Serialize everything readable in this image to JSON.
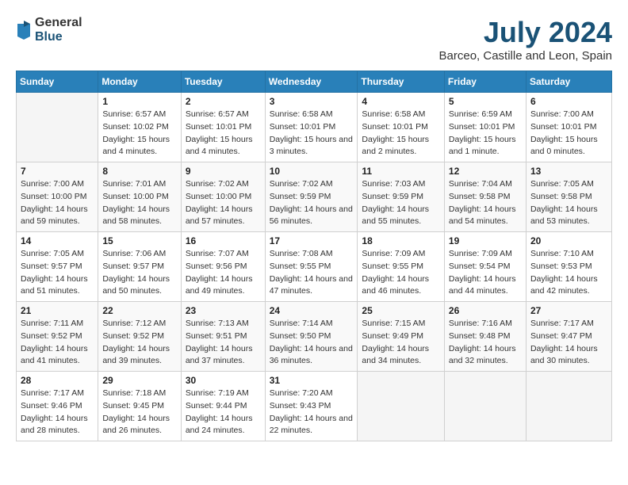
{
  "logo": {
    "general": "General",
    "blue": "Blue"
  },
  "title": "July 2024",
  "subtitle": "Barceo, Castille and Leon, Spain",
  "headers": [
    "Sunday",
    "Monday",
    "Tuesday",
    "Wednesday",
    "Thursday",
    "Friday",
    "Saturday"
  ],
  "weeks": [
    [
      {
        "day": "",
        "sunrise": "",
        "sunset": "",
        "daylight": ""
      },
      {
        "day": "1",
        "sunrise": "Sunrise: 6:57 AM",
        "sunset": "Sunset: 10:02 PM",
        "daylight": "Daylight: 15 hours and 4 minutes."
      },
      {
        "day": "2",
        "sunrise": "Sunrise: 6:57 AM",
        "sunset": "Sunset: 10:01 PM",
        "daylight": "Daylight: 15 hours and 4 minutes."
      },
      {
        "day": "3",
        "sunrise": "Sunrise: 6:58 AM",
        "sunset": "Sunset: 10:01 PM",
        "daylight": "Daylight: 15 hours and 3 minutes."
      },
      {
        "day": "4",
        "sunrise": "Sunrise: 6:58 AM",
        "sunset": "Sunset: 10:01 PM",
        "daylight": "Daylight: 15 hours and 2 minutes."
      },
      {
        "day": "5",
        "sunrise": "Sunrise: 6:59 AM",
        "sunset": "Sunset: 10:01 PM",
        "daylight": "Daylight: 15 hours and 1 minute."
      },
      {
        "day": "6",
        "sunrise": "Sunrise: 7:00 AM",
        "sunset": "Sunset: 10:01 PM",
        "daylight": "Daylight: 15 hours and 0 minutes."
      }
    ],
    [
      {
        "day": "7",
        "sunrise": "Sunrise: 7:00 AM",
        "sunset": "Sunset: 10:00 PM",
        "daylight": "Daylight: 14 hours and 59 minutes."
      },
      {
        "day": "8",
        "sunrise": "Sunrise: 7:01 AM",
        "sunset": "Sunset: 10:00 PM",
        "daylight": "Daylight: 14 hours and 58 minutes."
      },
      {
        "day": "9",
        "sunrise": "Sunrise: 7:02 AM",
        "sunset": "Sunset: 10:00 PM",
        "daylight": "Daylight: 14 hours and 57 minutes."
      },
      {
        "day": "10",
        "sunrise": "Sunrise: 7:02 AM",
        "sunset": "Sunset: 9:59 PM",
        "daylight": "Daylight: 14 hours and 56 minutes."
      },
      {
        "day": "11",
        "sunrise": "Sunrise: 7:03 AM",
        "sunset": "Sunset: 9:59 PM",
        "daylight": "Daylight: 14 hours and 55 minutes."
      },
      {
        "day": "12",
        "sunrise": "Sunrise: 7:04 AM",
        "sunset": "Sunset: 9:58 PM",
        "daylight": "Daylight: 14 hours and 54 minutes."
      },
      {
        "day": "13",
        "sunrise": "Sunrise: 7:05 AM",
        "sunset": "Sunset: 9:58 PM",
        "daylight": "Daylight: 14 hours and 53 minutes."
      }
    ],
    [
      {
        "day": "14",
        "sunrise": "Sunrise: 7:05 AM",
        "sunset": "Sunset: 9:57 PM",
        "daylight": "Daylight: 14 hours and 51 minutes."
      },
      {
        "day": "15",
        "sunrise": "Sunrise: 7:06 AM",
        "sunset": "Sunset: 9:57 PM",
        "daylight": "Daylight: 14 hours and 50 minutes."
      },
      {
        "day": "16",
        "sunrise": "Sunrise: 7:07 AM",
        "sunset": "Sunset: 9:56 PM",
        "daylight": "Daylight: 14 hours and 49 minutes."
      },
      {
        "day": "17",
        "sunrise": "Sunrise: 7:08 AM",
        "sunset": "Sunset: 9:55 PM",
        "daylight": "Daylight: 14 hours and 47 minutes."
      },
      {
        "day": "18",
        "sunrise": "Sunrise: 7:09 AM",
        "sunset": "Sunset: 9:55 PM",
        "daylight": "Daylight: 14 hours and 46 minutes."
      },
      {
        "day": "19",
        "sunrise": "Sunrise: 7:09 AM",
        "sunset": "Sunset: 9:54 PM",
        "daylight": "Daylight: 14 hours and 44 minutes."
      },
      {
        "day": "20",
        "sunrise": "Sunrise: 7:10 AM",
        "sunset": "Sunset: 9:53 PM",
        "daylight": "Daylight: 14 hours and 42 minutes."
      }
    ],
    [
      {
        "day": "21",
        "sunrise": "Sunrise: 7:11 AM",
        "sunset": "Sunset: 9:52 PM",
        "daylight": "Daylight: 14 hours and 41 minutes."
      },
      {
        "day": "22",
        "sunrise": "Sunrise: 7:12 AM",
        "sunset": "Sunset: 9:52 PM",
        "daylight": "Daylight: 14 hours and 39 minutes."
      },
      {
        "day": "23",
        "sunrise": "Sunrise: 7:13 AM",
        "sunset": "Sunset: 9:51 PM",
        "daylight": "Daylight: 14 hours and 37 minutes."
      },
      {
        "day": "24",
        "sunrise": "Sunrise: 7:14 AM",
        "sunset": "Sunset: 9:50 PM",
        "daylight": "Daylight: 14 hours and 36 minutes."
      },
      {
        "day": "25",
        "sunrise": "Sunrise: 7:15 AM",
        "sunset": "Sunset: 9:49 PM",
        "daylight": "Daylight: 14 hours and 34 minutes."
      },
      {
        "day": "26",
        "sunrise": "Sunrise: 7:16 AM",
        "sunset": "Sunset: 9:48 PM",
        "daylight": "Daylight: 14 hours and 32 minutes."
      },
      {
        "day": "27",
        "sunrise": "Sunrise: 7:17 AM",
        "sunset": "Sunset: 9:47 PM",
        "daylight": "Daylight: 14 hours and 30 minutes."
      }
    ],
    [
      {
        "day": "28",
        "sunrise": "Sunrise: 7:17 AM",
        "sunset": "Sunset: 9:46 PM",
        "daylight": "Daylight: 14 hours and 28 minutes."
      },
      {
        "day": "29",
        "sunrise": "Sunrise: 7:18 AM",
        "sunset": "Sunset: 9:45 PM",
        "daylight": "Daylight: 14 hours and 26 minutes."
      },
      {
        "day": "30",
        "sunrise": "Sunrise: 7:19 AM",
        "sunset": "Sunset: 9:44 PM",
        "daylight": "Daylight: 14 hours and 24 minutes."
      },
      {
        "day": "31",
        "sunrise": "Sunrise: 7:20 AM",
        "sunset": "Sunset: 9:43 PM",
        "daylight": "Daylight: 14 hours and 22 minutes."
      },
      {
        "day": "",
        "sunrise": "",
        "sunset": "",
        "daylight": ""
      },
      {
        "day": "",
        "sunrise": "",
        "sunset": "",
        "daylight": ""
      },
      {
        "day": "",
        "sunrise": "",
        "sunset": "",
        "daylight": ""
      }
    ]
  ]
}
